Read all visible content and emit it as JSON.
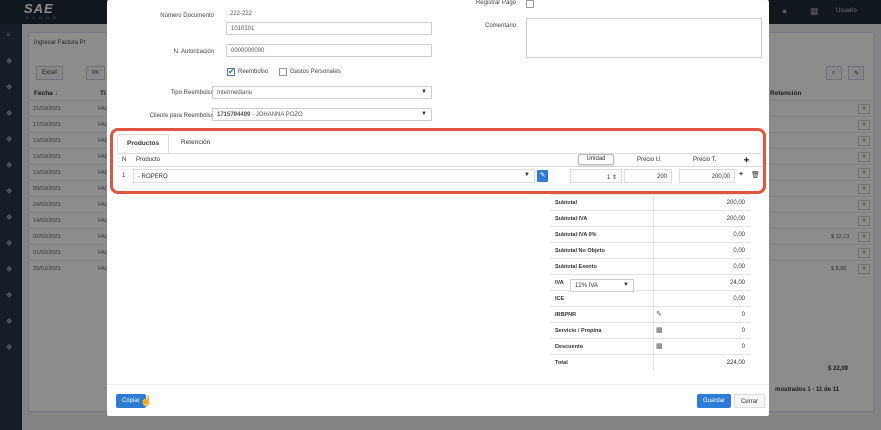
{
  "app": {
    "logo": "SAE",
    "logo_sub": "CLOUD",
    "user": "Usuario"
  },
  "background": {
    "page_title": "Ingresar Factura Pr",
    "excel_label": "Excel",
    "imp_label": "Im",
    "col_fecha": "Fecha ↓",
    "col_ti": "Ti",
    "col_retencion": "Retención",
    "rows": [
      {
        "fecha": "21/03/2023",
        "tipo": "FAC",
        "amount": ""
      },
      {
        "fecha": "17/03/2023",
        "tipo": "FAC",
        "amount": ""
      },
      {
        "fecha": "13/03/2023",
        "tipo": "FAC",
        "amount": ""
      },
      {
        "fecha": "13/03/2023",
        "tipo": "FAC",
        "amount": ""
      },
      {
        "fecha": "13/03/2023",
        "tipo": "FAC",
        "amount": ""
      },
      {
        "fecha": "09/03/2023",
        "tipo": "FAC",
        "amount": ""
      },
      {
        "fecha": "24/02/2023",
        "tipo": "FAC",
        "amount": ""
      },
      {
        "fecha": "14/02/2023",
        "tipo": "FAC",
        "amount": ""
      },
      {
        "fecha": "02/02/2023",
        "tipo": "FAC",
        "amount": "$ 12,13"
      },
      {
        "fecha": "01/02/2023",
        "tipo": "FAC",
        "amount": ""
      },
      {
        "fecha": "25/01/2023",
        "tipo": "FAC",
        "amount": "$ 8,96"
      }
    ],
    "total": "$ 22,09",
    "pagination": "mostrados 1 - 11 de 11"
  },
  "form": {
    "numero_documento_label": "Número Documento",
    "numero_documento_prefix": "222-222",
    "numero_documento_value": "1010101",
    "autorizacion_label": "N. Autorización",
    "autorizacion_value": "0000000000",
    "reembolso_label": "Reembolso",
    "gastos_label": "Gastos Personales",
    "tipo_reembolso_label": "Tipo Reembolso",
    "tipo_reembolso_value": "Intermediario",
    "cliente_label": "Cliente para Reembolso",
    "cliente_id": "1715794499",
    "cliente_name": " - JOHANNA POZO",
    "registrar_pago_label": "Registrar Pago",
    "comentario_label": "Comentario",
    "comentario_value": ""
  },
  "tabs": {
    "productos": "Productos",
    "retencion": "Retención"
  },
  "products_table": {
    "headers": {
      "n": "N",
      "producto": "Producto",
      "unidad": "Unidad",
      "precio_u": "Precio U.",
      "precio_t": "Precio T."
    },
    "tooltip": "Unidad",
    "rows": [
      {
        "n": "1",
        "producto": "- ROPERO",
        "cantidad": "1",
        "precio_u": "200",
        "precio_t": "200,00"
      }
    ]
  },
  "totals": [
    {
      "k": "Subtotal",
      "v": "200,00",
      "icon": ""
    },
    {
      "k": "Subtotal IVA",
      "v": "200,00",
      "icon": ""
    },
    {
      "k": "Subtotal IVA 0%",
      "v": "0,00",
      "icon": ""
    },
    {
      "k": "Subtotal No Objeto",
      "v": "0,00",
      "icon": ""
    },
    {
      "k": "Subtotal Exento",
      "v": "0,00",
      "icon": ""
    },
    {
      "k": "IVA",
      "v": "24,00",
      "icon": ""
    },
    {
      "k": "ICE",
      "v": "0,00",
      "icon": ""
    },
    {
      "k": "IRBPNR",
      "v": "0",
      "icon": "pencil"
    },
    {
      "k": "Servicio / Propina",
      "v": "0",
      "icon": "calc"
    },
    {
      "k": "Descuento",
      "v": "0",
      "icon": "calc"
    },
    {
      "k": "Total",
      "v": "224,00",
      "icon": ""
    }
  ],
  "iva_select": "12% IVA",
  "buttons": {
    "copiar": "Copiar",
    "guardar": "Guardar",
    "cerrar": "Cerrar"
  }
}
